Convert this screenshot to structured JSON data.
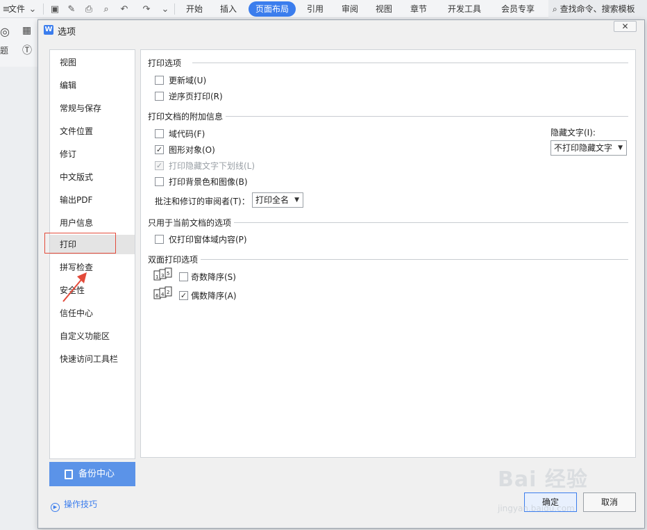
{
  "toolbar": {
    "file_label": "文件",
    "tabs": [
      "开始",
      "插入",
      "页面布局",
      "引用",
      "审阅",
      "视图",
      "章节",
      "开发工具",
      "会员专享"
    ],
    "active_tab": "页面布局",
    "search_placeholder": "查找命令、搜索模板"
  },
  "app_left": {
    "theme_label": "题"
  },
  "dialog": {
    "title": "选项",
    "logo": "W",
    "nav_items": [
      "视图",
      "编辑",
      "常规与保存",
      "文件位置",
      "修订",
      "中文版式",
      "输出PDF",
      "用户信息",
      "打印",
      "拼写检查",
      "安全性",
      "信任中心",
      "自定义功能区",
      "快速访问工具栏"
    ],
    "selected_nav": "打印",
    "backup_label": "备份中心",
    "tips_label": "操作技巧",
    "ok_label": "确定",
    "cancel_label": "取消"
  },
  "print": {
    "section1": "打印选项",
    "update_fields": {
      "label": "更新域(U)",
      "checked": false
    },
    "reverse_order": {
      "label": "逆序页打印(R)",
      "checked": false
    },
    "section2": "打印文档的附加信息",
    "field_codes": {
      "label": "域代码(F)",
      "checked": false
    },
    "drawing_objects": {
      "label": "图形对象(O)",
      "checked": true
    },
    "hidden_underline": {
      "label": "打印隐藏文字下划线(L)",
      "checked": true,
      "disabled": true
    },
    "background": {
      "label": "打印背景色和图像(B)",
      "checked": false
    },
    "reviewer_label": "批注和修订的审阅者(T)：",
    "reviewer_value": "打印全名",
    "hidden_text_label": "隐藏文字(I):",
    "hidden_text_value": "不打印隐藏文字",
    "section3": "只用于当前文档的选项",
    "form_only": {
      "label": "仅打印窗体域内容(P)",
      "checked": false
    },
    "section4": "双面打印选项",
    "odd_desc": {
      "label": "奇数降序(S)",
      "checked": false
    },
    "even_desc": {
      "label": "偶数降序(A)",
      "checked": true
    },
    "odd_icon_text": "135",
    "even_icon_text": "642"
  },
  "watermark": {
    "brand": "Bai  经验",
    "url": "jingyan.baidu.com"
  },
  "colors": {
    "accent": "#3b7ded",
    "highlight_box": "#e34a3a",
    "backup_button": "#5b93e8"
  }
}
